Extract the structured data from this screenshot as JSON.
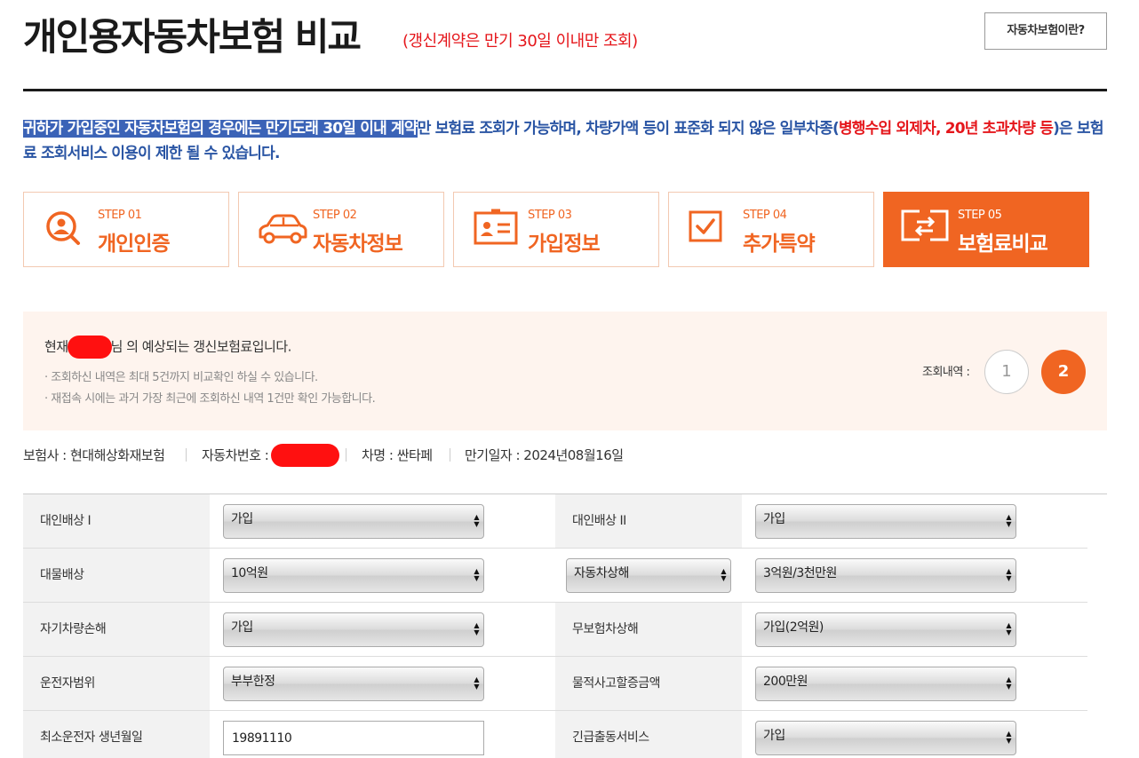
{
  "header": {
    "title": "개인용자동차보험 비교",
    "note": "(갱신계약은 만기 30일 이내만 조회)",
    "about_button": "자동차보험이란?"
  },
  "notice": {
    "highlighted": "귀하가 가입중인 자동차보험의 경우에는 만기도래 30일 이내 계약",
    "text1": "만 보험료 조회가 가능하며, 차량가액 등이 표준화 되지 않은 일부차종(",
    "red": "병행수입 외제차, 20년 초과차량 등",
    "text2": ")은 보험료 조회서비스 이용이 제한 될 수 있습니다."
  },
  "steps": [
    {
      "num": "STEP 01",
      "name": "개인인증",
      "icon": "person-search-icon"
    },
    {
      "num": "STEP 02",
      "name": "자동차정보",
      "icon": "car-icon"
    },
    {
      "num": "STEP 03",
      "name": "가입정보",
      "icon": "id-card-icon"
    },
    {
      "num": "STEP 04",
      "name": "추가특약",
      "icon": "checkbox-icon"
    },
    {
      "num": "STEP 05",
      "name": "보험료비교",
      "icon": "compare-arrows-icon",
      "active": true
    }
  ],
  "info": {
    "prefix": "현재",
    "suffix": "님 의 예상되는 갱신보험료입니다.",
    "note1": "· 조회하신 내역은 최대 5건까지 비교확인 하실 수 있습니다.",
    "note2": "· 재접속 시에는 과거 가장 최근에 조회하신 내역 1건만 확인 가능합니다.",
    "history_label": "조회내역 :",
    "history": [
      "1",
      "2"
    ],
    "history_active": "2"
  },
  "meta": {
    "insurer": "보험사 : 현대해상화재보험",
    "car_no_label": "자동차번호 :",
    "car_name": "차명 : 싼타페",
    "expiry": "만기일자 : 2024년08월16일"
  },
  "form": {
    "rows": [
      {
        "left_label": "대인배상 I",
        "left_value": "가입",
        "right_label": "대인배상 II",
        "right_value": "가입"
      },
      {
        "left_label": "대물배상",
        "left_value": "10억원",
        "right_select_label": "자동차상해",
        "right_value": "3억원/3천만원"
      },
      {
        "left_label": "자기차량손해",
        "left_value": "가입",
        "right_label": "무보험차상해",
        "right_value": "가입(2억원)"
      },
      {
        "left_label": "운전자범위",
        "left_value": "부부한정",
        "right_label": "물적사고할증금액",
        "right_value": "200만원"
      },
      {
        "left_label": "최소운전자 생년월일",
        "left_value": "19891110",
        "right_label": "긴급출동서비스",
        "right_value": "가입"
      }
    ]
  },
  "colors": {
    "accent": "#f06522",
    "notice_blue": "#2a55a4",
    "red": "#e5161b",
    "info_bg": "#fef4ee"
  }
}
